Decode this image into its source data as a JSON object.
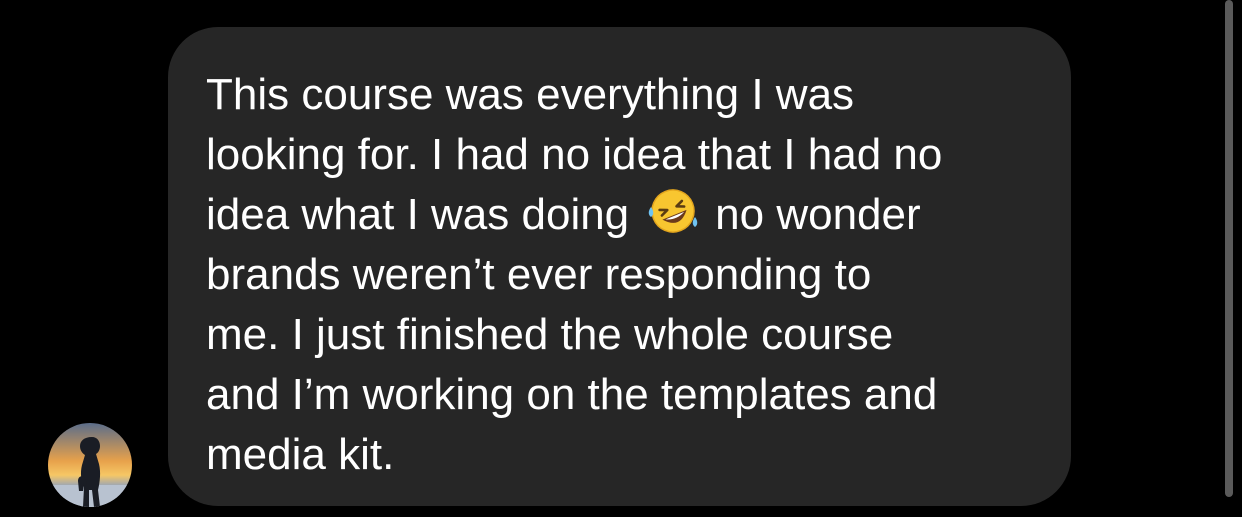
{
  "message": {
    "lines": [
      "This course was everything I was",
      "looking for. I had no idea that I had no",
      "idea what I was doing",
      "no wonder",
      "brands weren’t ever responding to",
      "me. I just finished the whole course",
      "and I’m working on the templates and",
      "media kit."
    ],
    "emoji_icon": "rolling-on-floor-laughing-icon"
  },
  "avatar": {
    "icon": "sunset-silhouette-avatar"
  },
  "colors": {
    "background": "#000000",
    "bubble": "#262626",
    "text": "#ffffff",
    "scrollbar": "#5a5a5a"
  }
}
